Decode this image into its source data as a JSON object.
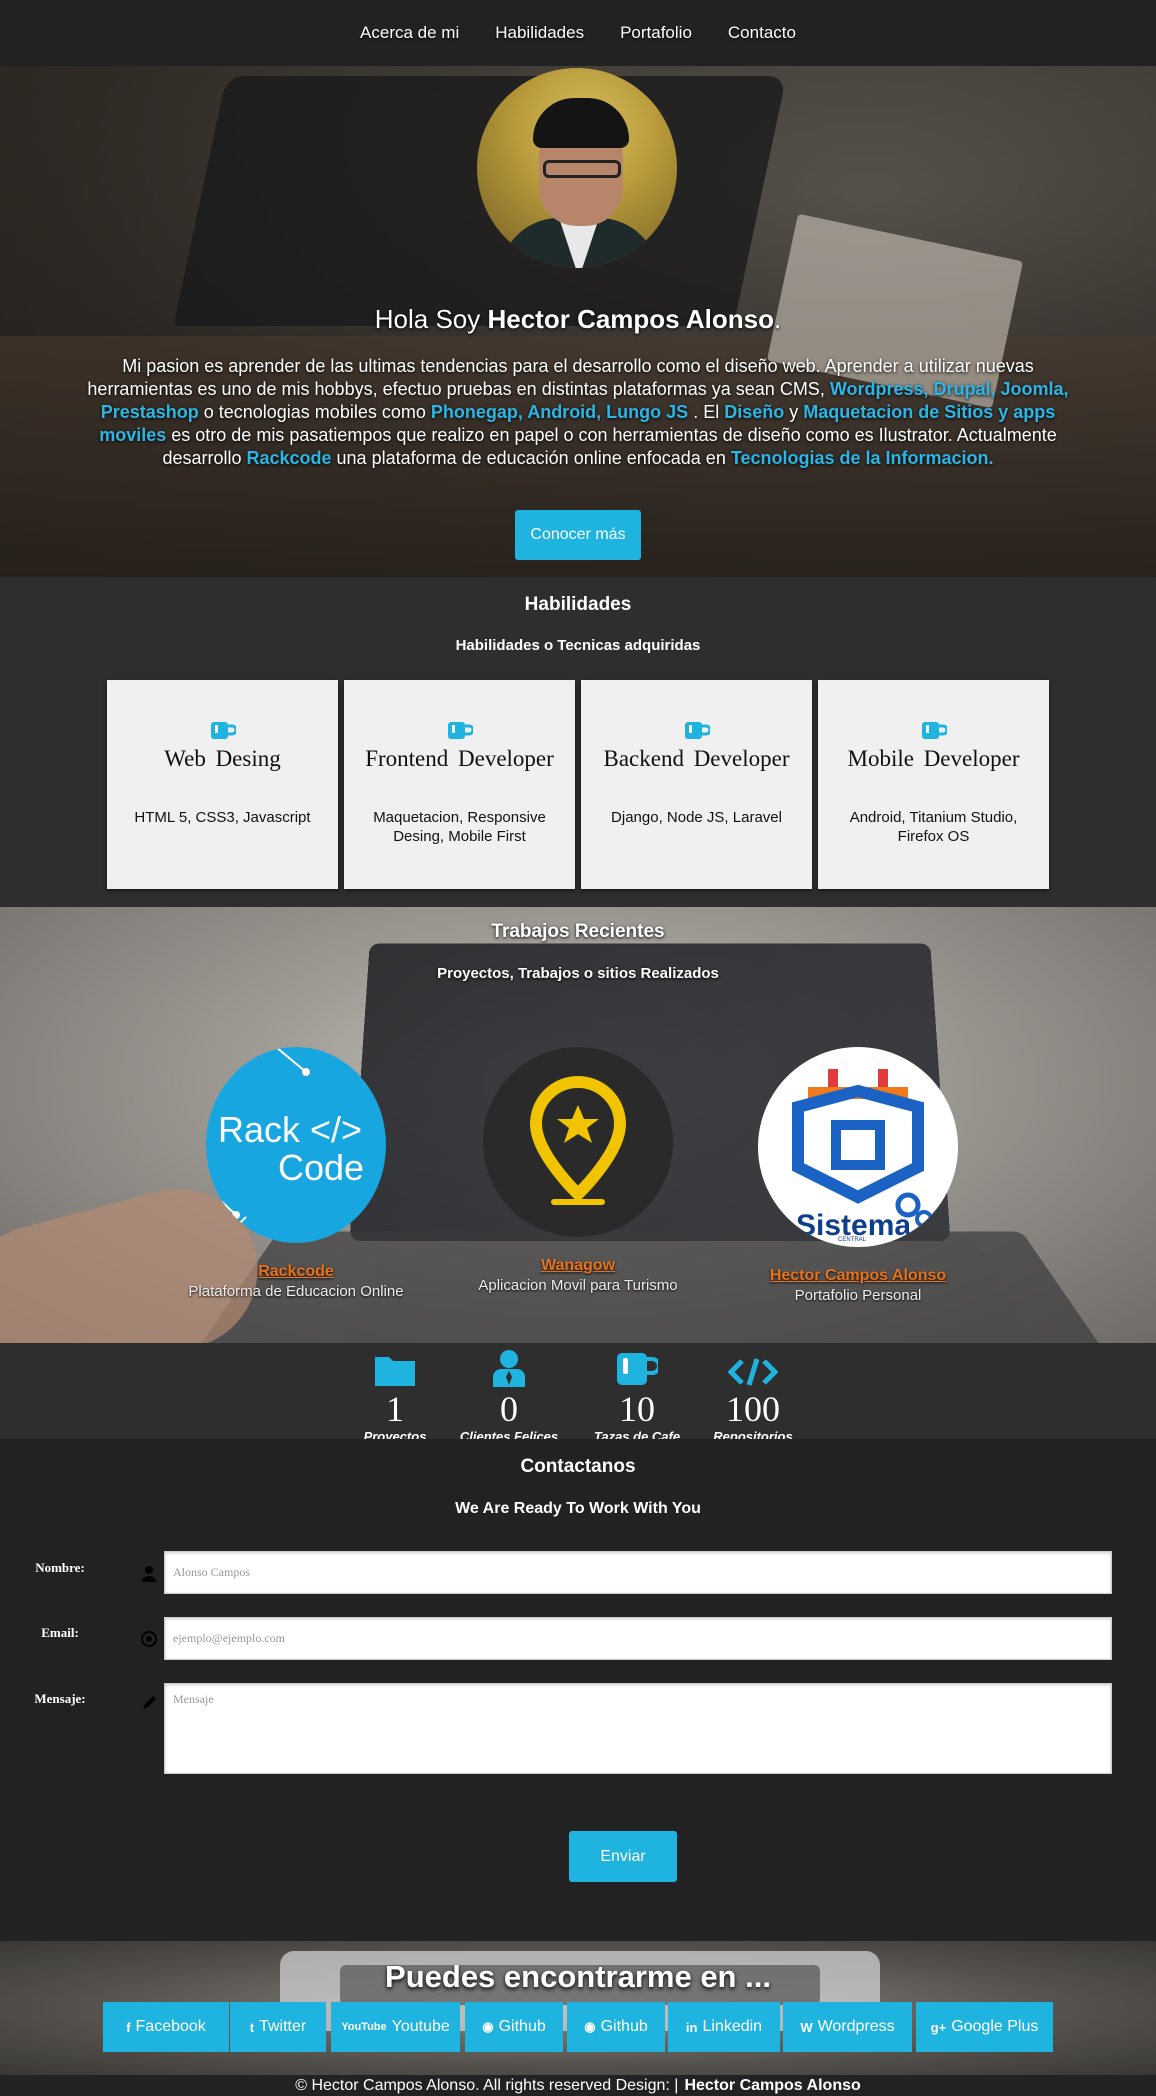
{
  "nav": [
    "Acerca de mi",
    "Habilidades",
    "Portafolio",
    "Contacto"
  ],
  "hero": {
    "greeting": "Hola Soy ",
    "name": "Hector Campos Alonso",
    "period": ".",
    "bio": [
      {
        "t": "Mi pasion es aprender de las ultimas tendencias para el desarrollo como el diseño web. Aprender a utilizar nuevas herramientas es uno de mis hobbys, efectuo pruebas en distintas plataformas ya sean CMS, ",
        "h": false
      },
      {
        "t": "Wordpress, Drupal, Joomla, Prestashop",
        "h": true
      },
      {
        "t": " o tecnologias mobiles como ",
        "h": false
      },
      {
        "t": "Phonegap, Android, Lungo JS ",
        "h": true
      },
      {
        "t": ". El ",
        "h": false
      },
      {
        "t": "Diseño",
        "h": true
      },
      {
        "t": " y ",
        "h": false
      },
      {
        "t": "Maquetacion de Sitios y apps moviles",
        "h": true
      },
      {
        "t": " es otro de mis pasatiempos que realizo en papel o con herramientas de diseño como es Ilustrator. Actualmente desarrollo ",
        "h": false
      },
      {
        "t": "Rackcode",
        "h": true
      },
      {
        "t": " una plataforma de educación online enfocada en ",
        "h": false
      },
      {
        "t": "Tecnologias de la Informacion.",
        "h": true
      }
    ],
    "button": "Conocer más"
  },
  "skills": {
    "title": "Habilidades",
    "subtitle": "Habilidades o Tecnicas adquiridas",
    "cards": [
      {
        "title": "Web Desing",
        "desc": "HTML 5, CSS3, Javascript"
      },
      {
        "title": "Frontend Developer",
        "desc": "Maquetacion, Responsive Desing, Mobile First"
      },
      {
        "title": "Backend Developer",
        "desc": "Django, Node JS, Laravel"
      },
      {
        "title": "Mobile Developer",
        "desc": "Android, Titanium Studio, Firefox OS"
      }
    ]
  },
  "works": {
    "title": "Trabajos Recientes",
    "subtitle": "Proyectos, Trabajos o sitios Realizados",
    "items": [
      {
        "name": "Rackcode",
        "desc": "Plataforma de Educacion Online",
        "logo_text_1": "Rack </>",
        "logo_text_2": "Code"
      },
      {
        "name": "Wanagow",
        "desc": "Aplicacion Movil para Turismo"
      },
      {
        "name": "Hector Campos Alonso",
        "desc": "Portafolio Personal",
        "logo_text_1": "Sistema",
        "logo_text_2": "CENTRAL"
      }
    ]
  },
  "stats": [
    {
      "icon": "folder-icon",
      "value": "1",
      "label": "Proyectos"
    },
    {
      "icon": "user-icon",
      "value": "0",
      "label": "Clientes Felices"
    },
    {
      "icon": "coffee-cup-icon",
      "value": "10",
      "label": "Tazas de Cafe"
    },
    {
      "icon": "code-icon",
      "value": "100",
      "label": "Repositorios"
    }
  ],
  "contact": {
    "title": "Contactanos",
    "subtitle": "We Are Ready To Work With You",
    "name_label": "Nombre:",
    "name_placeholder": "Alonso Campos",
    "email_label": "Email:",
    "email_placeholder": "ejemplo@ejemplo.com",
    "message_label": "Mensaje:",
    "message_placeholder": "Mensaje",
    "submit": "Enviar"
  },
  "social": {
    "title": "Puedes encontrarme en ...",
    "links": [
      {
        "label": "Facebook",
        "icon": "facebook-icon",
        "glyph": "f"
      },
      {
        "label": "Twitter",
        "icon": "twitter-icon",
        "glyph": "t"
      },
      {
        "label": "Youtube",
        "icon": "youtube-icon",
        "glyph": "YouTube"
      },
      {
        "label": "Github",
        "icon": "github-icon",
        "glyph": "◉"
      },
      {
        "label": "Github",
        "icon": "github-icon",
        "glyph": "◉"
      },
      {
        "label": "Linkedin",
        "icon": "linkedin-icon",
        "glyph": "in"
      },
      {
        "label": "Wordpress",
        "icon": "wordpress-icon",
        "glyph": "W"
      },
      {
        "label": "Google Plus",
        "icon": "google-plus-icon",
        "glyph": "g+"
      }
    ]
  },
  "footer": {
    "text": "© Hector Campos Alonso. All rights reserved Design: |",
    "author": "Hector Campos Alonso"
  },
  "colors": {
    "accent": "#1fb4df",
    "link_orange": "#e8731a",
    "nav_bg": "#222222",
    "section_bg": "#2e2e2e"
  }
}
